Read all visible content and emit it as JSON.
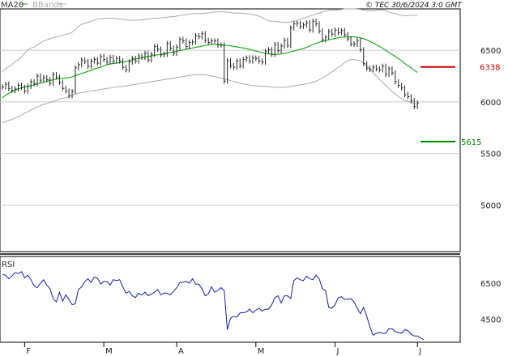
{
  "header": {
    "legend_ma": "MA20",
    "legend_bb": "BBands",
    "copyright": "© TEC 30/6/2024 3:0 GMT"
  },
  "colors": {
    "ma": "#1faa1f",
    "bbands": "#aaaaaa",
    "rsi": "#1a1aaa",
    "resistance": "#cc0000",
    "support": "#008800",
    "grid": "#cccccc",
    "price": "#222222"
  },
  "chart_data": [
    {
      "type": "line",
      "panel": "price",
      "series_legend": [
        "MA20",
        "BBands"
      ],
      "y_ticks": [
        5000,
        5500,
        6000,
        6500
      ],
      "y_tick_labels": [
        "5000",
        "5500",
        "6000",
        "6500"
      ],
      "ylim": [
        4550,
        6900
      ],
      "x_ticks": [
        "F",
        "M",
        "A",
        "M",
        "J",
        "J"
      ],
      "x_tick_index": [
        7,
        32,
        55,
        80,
        105,
        131
      ],
      "n_bars": 132,
      "close": [
        6145,
        6170,
        6130,
        6110,
        6125,
        6160,
        6140,
        6105,
        6150,
        6195,
        6175,
        6250,
        6210,
        6235,
        6215,
        6180,
        6265,
        6240,
        6190,
        6130,
        6105,
        6060,
        6100,
        6330,
        6360,
        6405,
        6390,
        6345,
        6395,
        6410,
        6375,
        6440,
        6410,
        6385,
        6430,
        6395,
        6420,
        6395,
        6335,
        6310,
        6385,
        6420,
        6395,
        6445,
        6430,
        6470,
        6405,
        6460,
        6535,
        6510,
        6455,
        6460,
        6565,
        6520,
        6470,
        6530,
        6605,
        6590,
        6535,
        6575,
        6580,
        6640,
        6630,
        6660,
        6595,
        6575,
        6590,
        6590,
        6550,
        6550,
        6200,
        6400,
        6350,
        6335,
        6395,
        6350,
        6410,
        6425,
        6395,
        6425,
        6420,
        6395,
        6385,
        6490,
        6505,
        6460,
        6555,
        6495,
        6540,
        6595,
        6545,
        6715,
        6755,
        6760,
        6730,
        6745,
        6765,
        6695,
        6780,
        6755,
        6685,
        6600,
        6625,
        6680,
        6655,
        6695,
        6670,
        6690,
        6650,
        6610,
        6560,
        6555,
        6595,
        6505,
        6370,
        6325,
        6315,
        6335,
        6320,
        6310,
        6345,
        6265,
        6320,
        6280,
        6195,
        6160,
        6135,
        6070,
        6050,
        6010,
        5955,
        5990
      ],
      "ma20": [
        6040,
        6065,
        6083,
        6100,
        6114,
        6125,
        6135,
        6143,
        6150,
        6157,
        6165,
        6172,
        6182,
        6190,
        6198,
        6207,
        6213,
        6220,
        6227,
        6228,
        6230,
        6235,
        6242,
        6254,
        6265,
        6275,
        6285,
        6296,
        6306,
        6318,
        6328,
        6336,
        6348,
        6360,
        6367,
        6371,
        6376,
        6381,
        6385,
        6391,
        6398,
        6406,
        6415,
        6421,
        6427,
        6433,
        6439,
        6444,
        6450,
        6455,
        6460,
        6466,
        6472,
        6478,
        6484,
        6490,
        6497,
        6503,
        6510,
        6516,
        6522,
        6528,
        6533,
        6540,
        6545,
        6550,
        6557,
        6557,
        6555,
        6552,
        6548,
        6546,
        6543,
        6537,
        6532,
        6526,
        6522,
        6516,
        6508,
        6500,
        6492,
        6484,
        6476,
        6470,
        6465,
        6461,
        6458,
        6459,
        6464,
        6471,
        6476,
        6484,
        6492,
        6500,
        6508,
        6517,
        6527,
        6540,
        6554,
        6566,
        6577,
        6586,
        6594,
        6601,
        6608,
        6614,
        6620,
        6625,
        6628,
        6629,
        6630,
        6629,
        6626,
        6620,
        6612,
        6600,
        6585,
        6570,
        6554,
        6537,
        6519,
        6500,
        6480,
        6460,
        6440,
        6419,
        6396,
        6371,
        6350,
        6329,
        6306,
        6285
      ],
      "bb_upper": [
        6290,
        6320,
        6340,
        6360,
        6390,
        6405,
        6435,
        6470,
        6505,
        6520,
        6530,
        6550,
        6570,
        6590,
        6600,
        6610,
        6620,
        6630,
        6635,
        6645,
        6655,
        6660,
        6675,
        6700,
        6730,
        6750,
        6760,
        6770,
        6780,
        6790,
        6800,
        6805,
        6808,
        6810,
        6810,
        6810,
        6805,
        6800,
        6800,
        6795,
        6790,
        6790,
        6790,
        6790,
        6795,
        6800,
        6800,
        6805,
        6810,
        6810,
        6815,
        6815,
        6820,
        6825,
        6825,
        6830,
        6835,
        6840,
        6845,
        6850,
        6855,
        6855,
        6855,
        6855,
        6860,
        6860,
        6865,
        6870,
        6870,
        6875,
        6870,
        6868,
        6865,
        6860,
        6860,
        6860,
        6855,
        6855,
        6850,
        6845,
        6838,
        6830,
        6815,
        6800,
        6785,
        6780,
        6780,
        6775,
        6772,
        6770,
        6770,
        6775,
        6780,
        6790,
        6800,
        6810,
        6820,
        6830,
        6840,
        6850,
        6860,
        6870,
        6878,
        6885,
        6888,
        6890,
        6892,
        6895,
        6900,
        6900,
        6900,
        6900,
        6898,
        6895,
        6890,
        6885,
        6882,
        6880,
        6885,
        6890,
        6890,
        6880,
        6870,
        6862,
        6855,
        6845,
        6838,
        6833,
        6835,
        6838,
        6840,
        6835
      ],
      "bb_lower": [
        5795,
        5810,
        5820,
        5830,
        5845,
        5855,
        5870,
        5890,
        5905,
        5920,
        5935,
        5950,
        5965,
        5975,
        5985,
        5995,
        6005,
        6015,
        6025,
        6035,
        6040,
        6050,
        6060,
        6075,
        6085,
        6090,
        6095,
        6100,
        6105,
        6110,
        6115,
        6120,
        6125,
        6130,
        6135,
        6140,
        6145,
        6148,
        6150,
        6155,
        6160,
        6165,
        6170,
        6175,
        6180,
        6185,
        6190,
        6195,
        6200,
        6205,
        6210,
        6215,
        6220,
        6225,
        6230,
        6235,
        6240,
        6245,
        6250,
        6255,
        6260,
        6265,
        6265,
        6265,
        6262,
        6258,
        6250,
        6245,
        6237,
        6230,
        6222,
        6215,
        6205,
        6198,
        6190,
        6180,
        6175,
        6168,
        6163,
        6158,
        6156,
        6153,
        6152,
        6150,
        6148,
        6145,
        6140,
        6140,
        6140,
        6140,
        6145,
        6150,
        6155,
        6160,
        6165,
        6170,
        6175,
        6180,
        6190,
        6200,
        6215,
        6230,
        6250,
        6270,
        6290,
        6310,
        6335,
        6355,
        6380,
        6400,
        6410,
        6410,
        6405,
        6395,
        6375,
        6350,
        6315,
        6280,
        6250,
        6220,
        6190,
        6160,
        6130,
        6100,
        6075,
        6050,
        6030,
        6015,
        6005,
        5995,
        5985,
        5975
      ]
    },
    {
      "type": "line",
      "panel": "rsi",
      "title": "RSI",
      "y_ticks": [
        45,
        65
      ],
      "y_tick_labels": [
        "4500",
        "6500"
      ],
      "ylim": [
        32,
        80
      ],
      "values": [
        70.0,
        69.5,
        67.5,
        69.0,
        71.0,
        70.5,
        71.5,
        68.0,
        69.5,
        67.0,
        63.5,
        62.5,
        65.0,
        67.0,
        64.0,
        62.0,
        56.5,
        54.5,
        60.0,
        55.0,
        58.5,
        56.0,
        53.0,
        53.5,
        61.5,
        63.0,
        66.0,
        67.5,
        65.5,
        68.5,
        68.0,
        64.5,
        66.0,
        66.0,
        64.0,
        67.0,
        66.5,
        67.0,
        63.0,
        59.5,
        60.5,
        58.0,
        57.0,
        59.5,
        58.5,
        60.0,
        58.0,
        59.0,
        60.0,
        61.5,
        58.5,
        59.5,
        59.5,
        58.5,
        60.5,
        62.5,
        65.5,
        65.5,
        66.0,
        65.0,
        67.5,
        64.5,
        64.5,
        62.0,
        58.0,
        59.0,
        63.0,
        60.0,
        61.0,
        62.5,
        61.0,
        39.0,
        45.5,
        46.5,
        46.0,
        48.5,
        48.5,
        49.0,
        50.5,
        48.5,
        50.0,
        51.0,
        49.5,
        50.5,
        50.5,
        53.0,
        57.0,
        58.0,
        54.0,
        58.0,
        58.0,
        56.5,
        66.5,
        68.0,
        67.0,
        66.5,
        69.0,
        67.5,
        67.0,
        69.5,
        67.5,
        62.0,
        61.0,
        51.5,
        51.0,
        53.0,
        57.0,
        57.5,
        56.0,
        56.0,
        56.5,
        54.5,
        51.0,
        48.0,
        51.5,
        46.5,
        40.5,
        36.0,
        37.0,
        37.5,
        37.0,
        37.0,
        39.5,
        39.5,
        38.0,
        37.5,
        37.0,
        39.0,
        38.5,
        36.5,
        35.5,
        35.5,
        34.5,
        33.5
      ]
    }
  ],
  "levels": {
    "resistance_label": "6338",
    "resistance_value": 6338,
    "support_label": "5615",
    "support_value": 5615
  }
}
